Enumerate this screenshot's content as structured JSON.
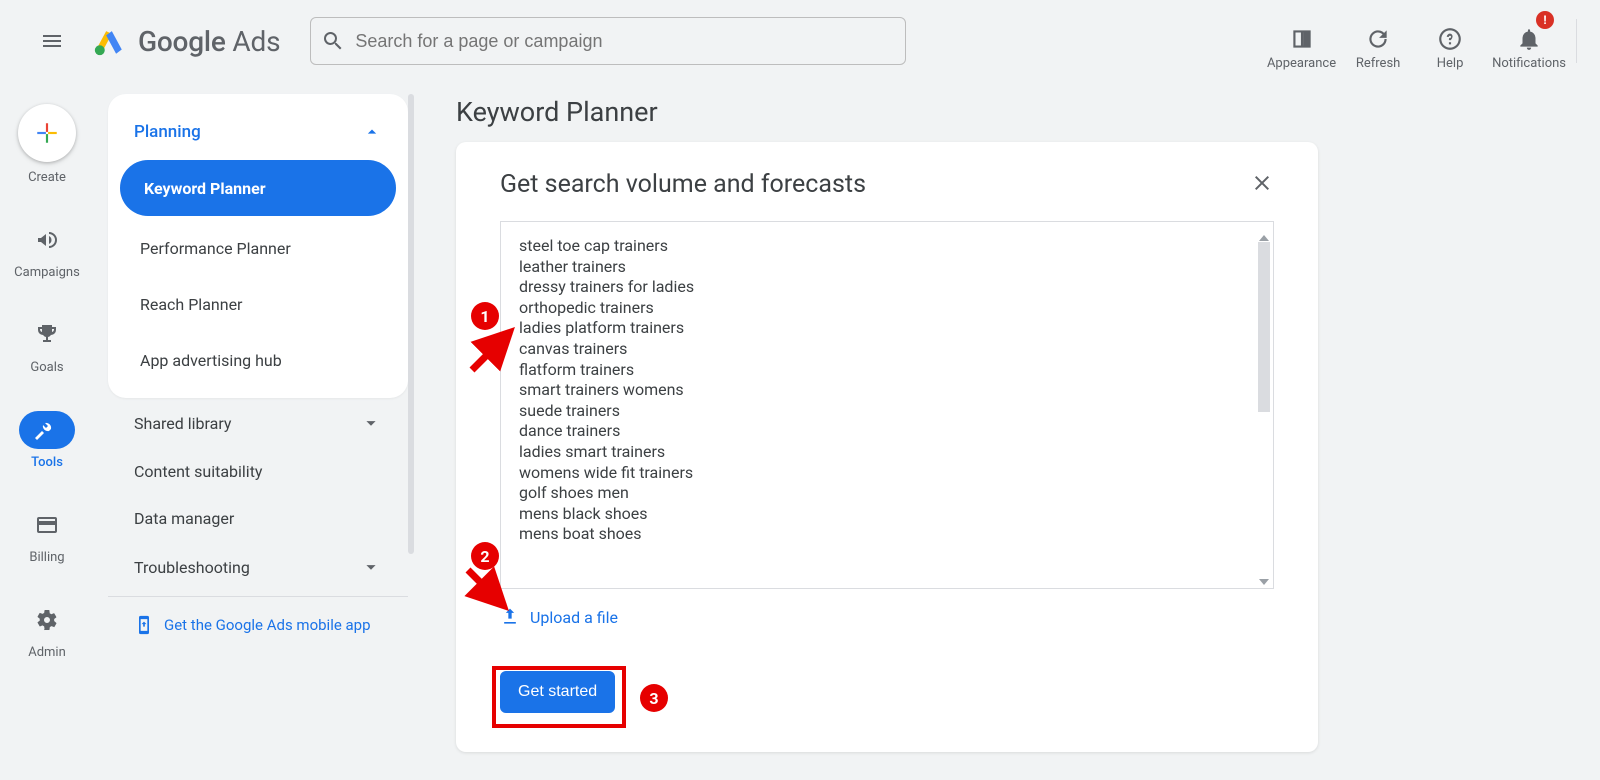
{
  "header": {
    "logo_text_main": "Google",
    "logo_text_sub": "Ads",
    "search_placeholder": "Search for a page or campaign",
    "actions": {
      "appearance": "Appearance",
      "refresh": "Refresh",
      "help": "Help",
      "notifications": "Notifications"
    }
  },
  "rail": {
    "create": "Create",
    "campaigns": "Campaigns",
    "goals": "Goals",
    "tools": "Tools",
    "billing": "Billing",
    "admin": "Admin"
  },
  "side": {
    "section": "Planning",
    "items": {
      "keyword_planner": "Keyword Planner",
      "performance_planner": "Performance Planner",
      "reach_planner": "Reach Planner",
      "app_hub": "App advertising hub"
    },
    "links": {
      "shared_library": "Shared library",
      "content_suitability": "Content suitability",
      "data_manager": "Data manager",
      "troubleshooting": "Troubleshooting"
    },
    "mobile_app": "Get the Google Ads mobile app"
  },
  "main": {
    "page_title": "Keyword Planner",
    "modal_title": "Get search volume and forecasts",
    "keywords": [
      "steel toe cap trainers",
      "leather trainers",
      "dressy trainers for ladies",
      "orthopedic trainers",
      "ladies platform trainers",
      "canvas trainers",
      "flatform trainers",
      "smart trainers womens",
      "suede trainers",
      "dance trainers",
      "ladies smart trainers",
      "womens wide fit trainers",
      "golf shoes men",
      "mens black shoes",
      "mens boat shoes"
    ],
    "upload_label": "Upload a file",
    "cta": "Get started"
  },
  "annotations": {
    "c1": "1",
    "c2": "2",
    "c3": "3"
  }
}
